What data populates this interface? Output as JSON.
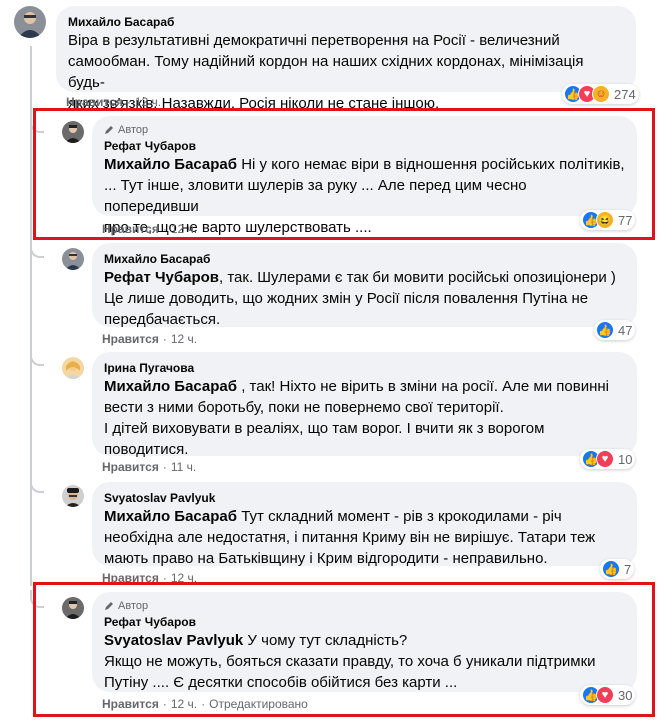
{
  "comments": [
    {
      "author": "Михайло Басараб",
      "line1": "Віра в результативні демократичні перетворення на Росії - величезний",
      "line2": "самообман. Тому надійний кордон на наших східних кордонах, мінімізація будь-",
      "line3": "яких зв'язків. Назавжди. Росія ніколи не стане іншою.",
      "like": "Нравится",
      "time": "12 ч.",
      "reactions_count": "274"
    },
    {
      "badge": "Автор",
      "author": "Рефат Чубаров",
      "mention": "Михайло Басараб",
      "line1": " Ні у кого немає віри в відношення російських політиків,",
      "line2": "... Тут інше, зловити шулерів за руку ... Але перед цим чесно попередивши",
      "line3": "про те, що не варто шулерствовать ....",
      "like": "Нравится",
      "time": "12 ч.",
      "reactions_count": "77"
    },
    {
      "author": "Михайло Басараб",
      "mention": "Рефат Чубаров",
      "line1": ", так. Шулерами є так би мовити російські опозиціонери )",
      "line2": "Це лише доводить, що жодних змін у Росії після повалення Путіна не",
      "line3": "передбачається.",
      "like": "Нравится",
      "time": "12 ч.",
      "reactions_count": "47"
    },
    {
      "author": "Ірина Пугачова",
      "mention": "Михайло Басараб",
      "line1": " , так! Ніхто не вірить в зміни на росії. Але ми повинні",
      "line2": "вести з ними боротьбу, поки не повернемо свої території.",
      "line3": "І дітей виховувати в реаліях, що там ворог. І вчити як з ворогом",
      "line4": "поводитися.",
      "like": "Нравится",
      "time": "11 ч.",
      "reactions_count": "10"
    },
    {
      "author": "Svyatoslav Pavlyuk",
      "mention": "Михайло Басараб",
      "line1": " Тут складний момент - рів з крокодилами - річ",
      "line2": "необхідна але недостатня, і питання Криму він не вирішує. Татари теж",
      "line3": "мають право на Батьківщину і Крим відгородити - неправильно.",
      "like": "Нравится",
      "time": "12 ч.",
      "reactions_count": "7"
    },
    {
      "badge": "Автор",
      "author": "Рефат Чубаров",
      "mention": "Svyatoslav Pavlyuk",
      "line1": " У чому тут складність?",
      "line2": "Якщо не можуть, бояться сказати правду, то хоча б уникали підтримки",
      "line3": "Путіну .... Є десятки способів обійтися без карти ...",
      "like": "Нравится",
      "time": "12 ч.",
      "edited": "Отредактировано",
      "reactions_count": "30"
    }
  ],
  "colors": {
    "bubble": "#f0f2f5",
    "highlight": "#e0121a",
    "like_blue": "#1877f2",
    "love_red": "#f33e58",
    "haha_yellow": "#f7b125"
  }
}
